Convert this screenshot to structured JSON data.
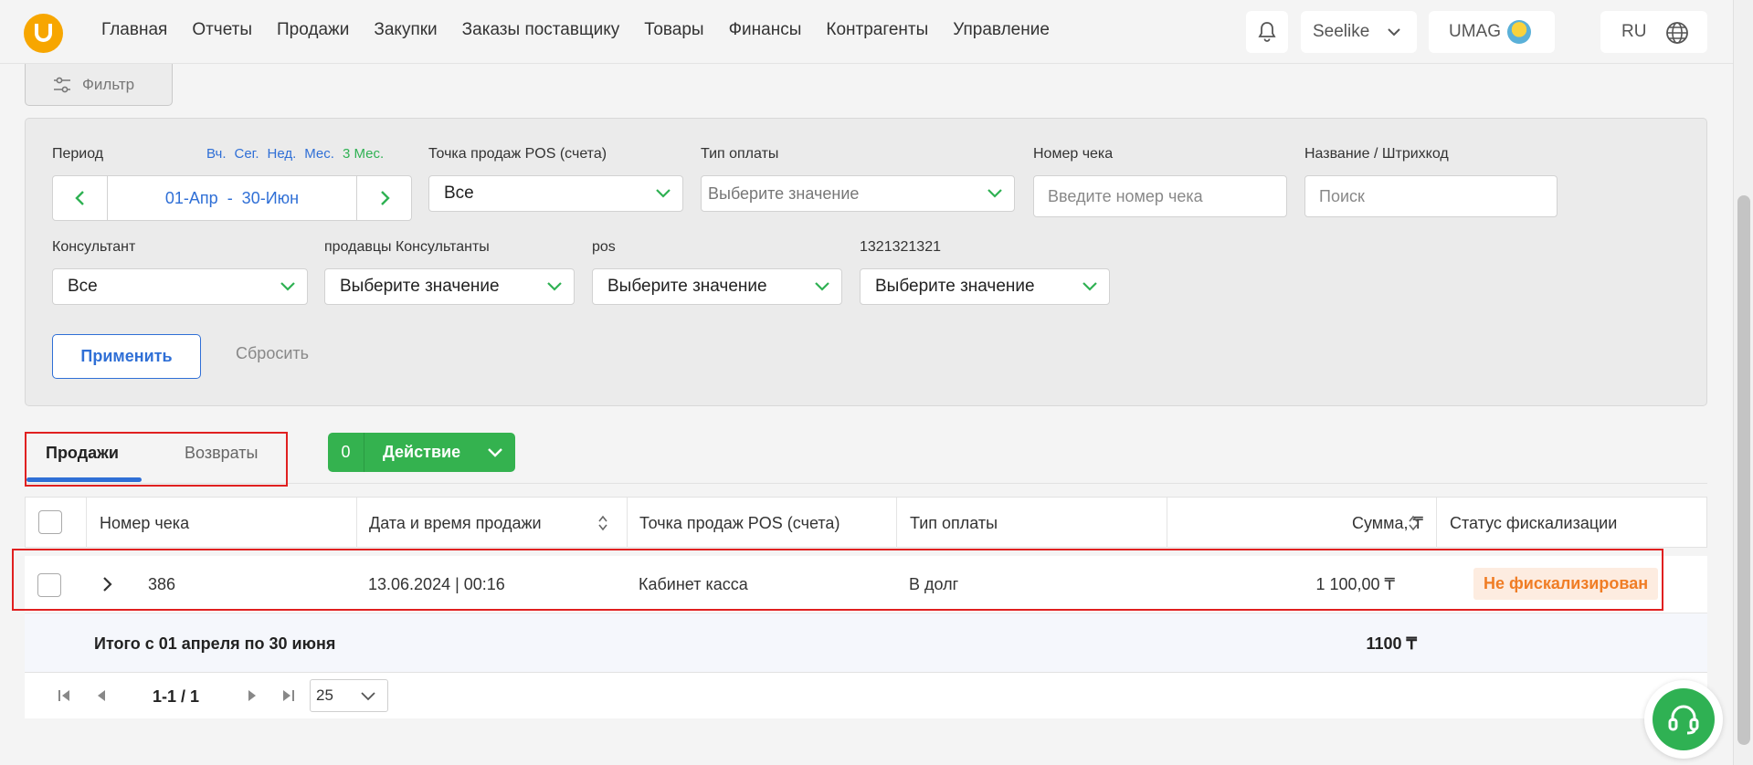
{
  "nav": {
    "items": [
      "Главная",
      "Отчеты",
      "Продажи",
      "Закупки",
      "Заказы поставщику",
      "Товары",
      "Финансы",
      "Контрагенты",
      "Управление"
    ],
    "org": "Seelike",
    "brand": "UMAG",
    "lang": "RU"
  },
  "filter": {
    "toggle_label": "Фильтр",
    "period_label": "Период",
    "quick": [
      "Вч.",
      "Сег.",
      "Нед.",
      "Мес.",
      "3 Мес."
    ],
    "period_range": "01-Апр  -  30-Июн",
    "pos_label": "Точка продаж POS (счета)",
    "pos_value": "Все",
    "payment_label": "Тип оплаты",
    "payment_placeholder": "Выберите значение",
    "receipt_label": "Номер чека",
    "receipt_placeholder": "Введите номер чека",
    "name_label": "Название / Штрихкод",
    "name_placeholder": "Поиск",
    "consultant_label": "Консультант",
    "consultant_value": "Все",
    "sellers_label": "продавцы Консультанты",
    "sellers_value": "Выберите значение",
    "pos2_label": "pos",
    "pos2_value": "Выберите значение",
    "custom_label": "1321321321",
    "custom_value": "Выберите значение",
    "apply": "Применить",
    "reset": "Сбросить"
  },
  "tabs": {
    "sales": "Продажи",
    "returns": "Возвраты"
  },
  "action": {
    "count": "0",
    "label": "Действие"
  },
  "table": {
    "headers": {
      "receipt": "Номер чека",
      "datetime": "Дата и время продажи",
      "pos": "Точка продаж POS (счета)",
      "payment": "Тип оплаты",
      "sum": "Сумма, ₸",
      "status": "Статус фискализации"
    },
    "rows": [
      {
        "receipt": "386",
        "datetime": "13.06.2024 | 00:16",
        "pos": "Кабинет касса",
        "payment": "В долг",
        "sum": "1 100,00 ₸",
        "status": "Не фискализирован"
      }
    ],
    "total_label": "Итого с 01 апреля по 30 июня",
    "total_value": "1100 ₸"
  },
  "pager": {
    "range": "1-1 / 1",
    "page_size": "25"
  },
  "colors": {
    "accent_blue": "#2f6fd6",
    "accent_green": "#34b24f",
    "warning_orange": "#f07d25",
    "highlight_red": "#e02020",
    "logo_orange": "#f7a600"
  }
}
